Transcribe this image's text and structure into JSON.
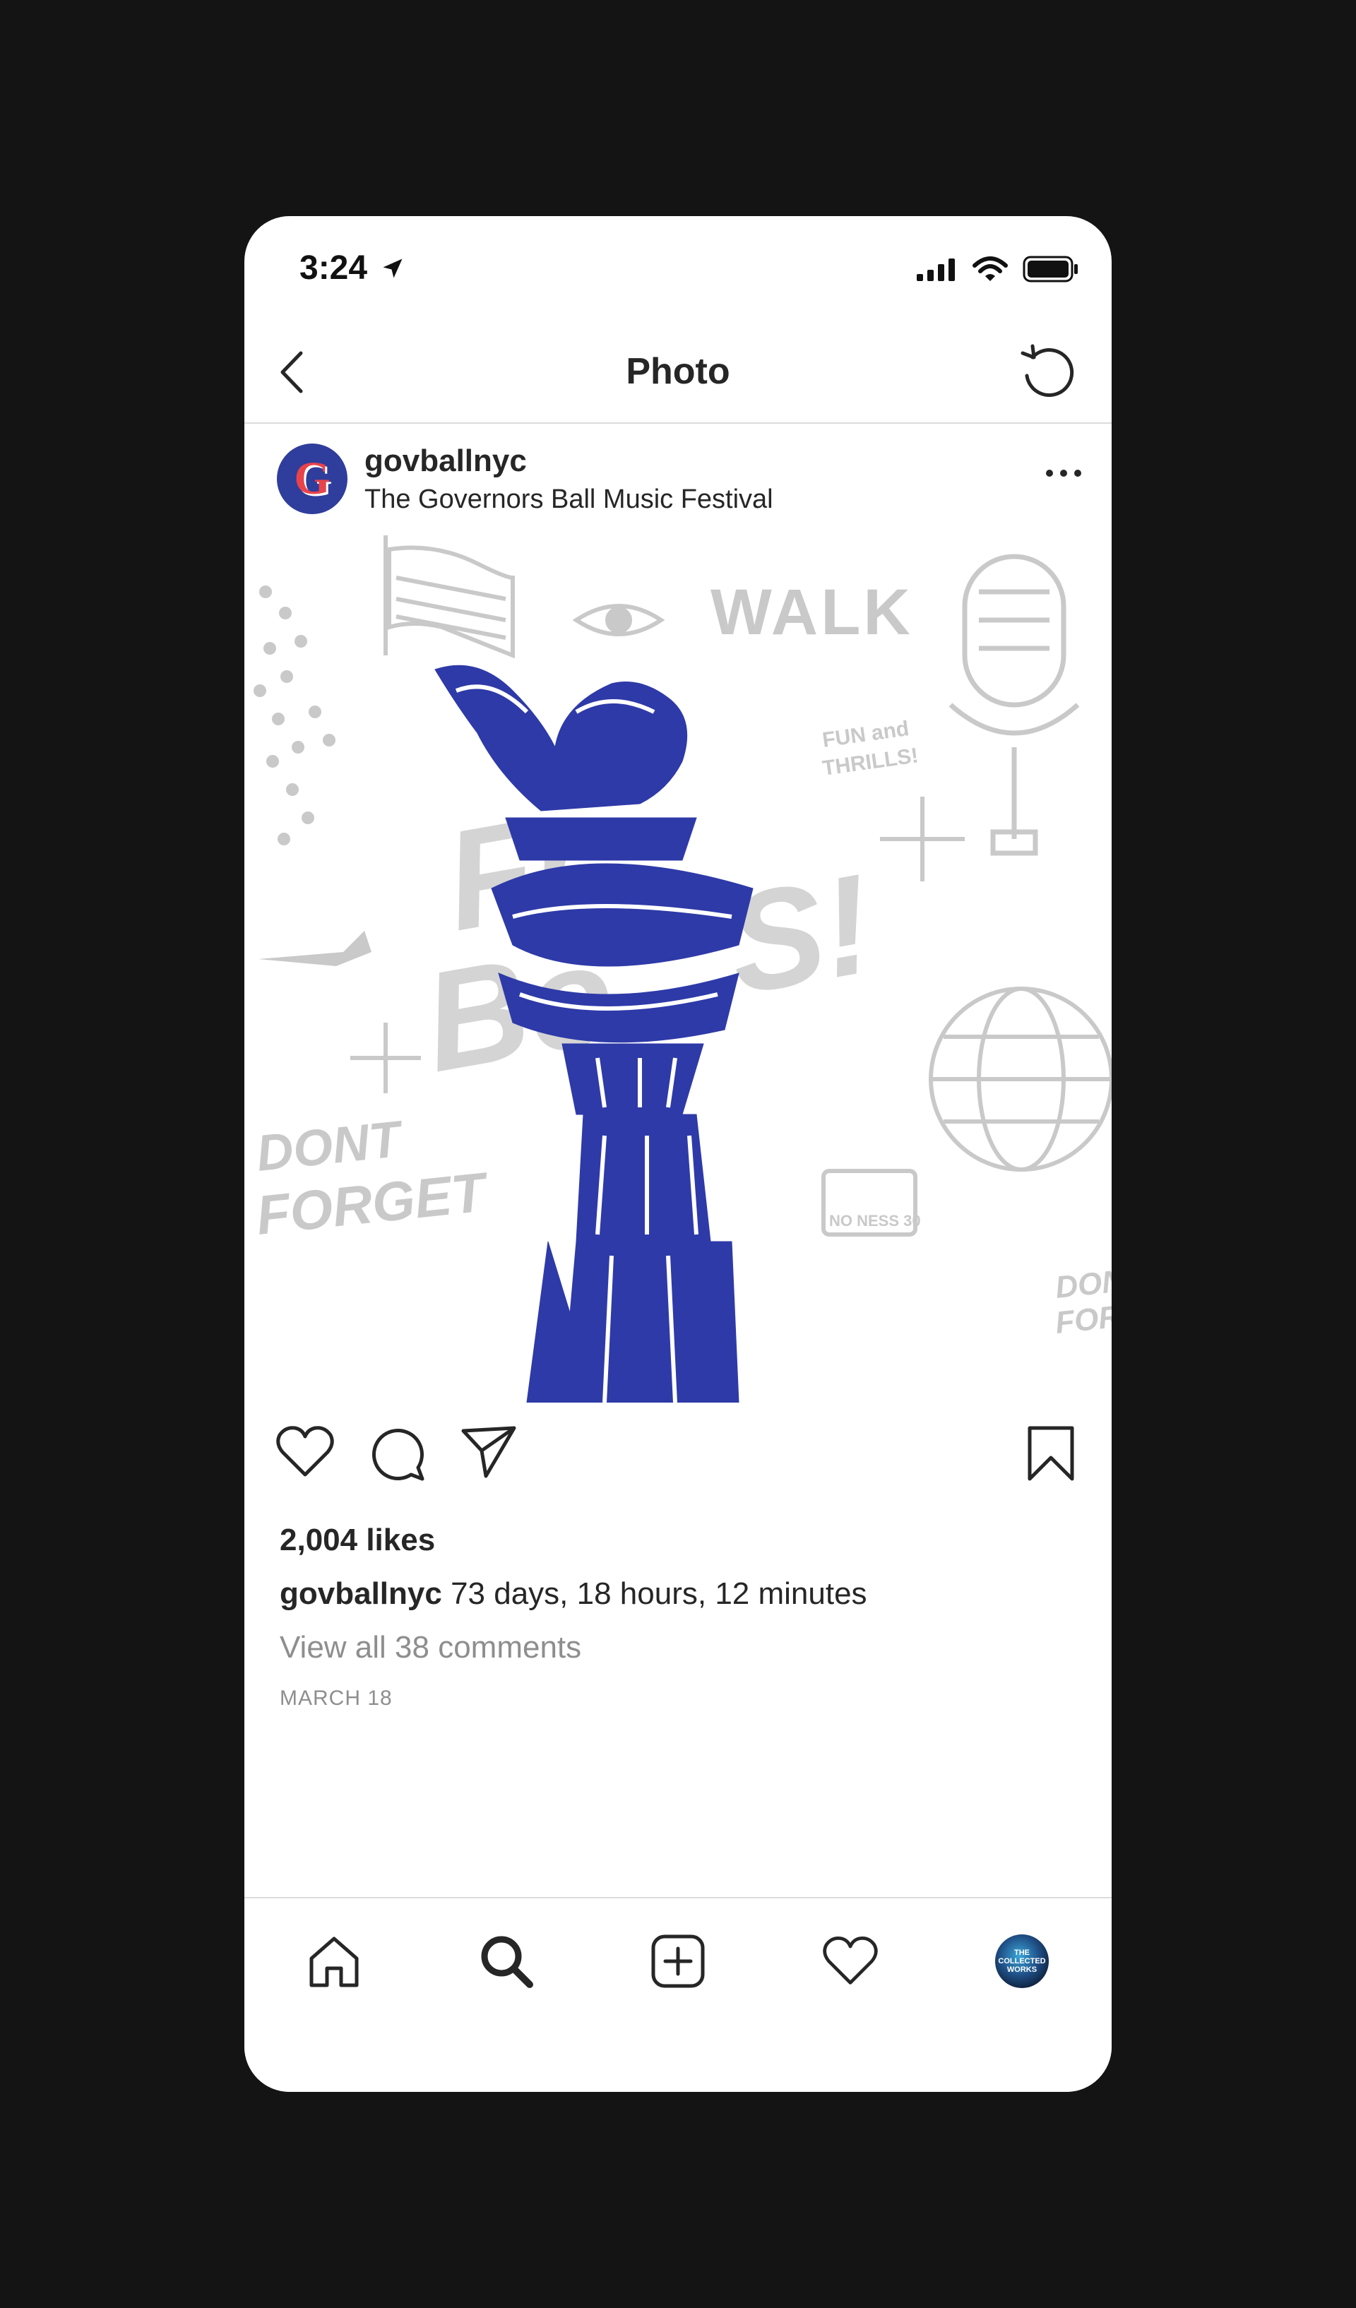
{
  "status_bar": {
    "time": "3:24",
    "icons": [
      "location-arrow-icon",
      "cellular-signal-icon",
      "wifi-icon",
      "battery-icon"
    ]
  },
  "nav": {
    "title": "Photo",
    "back_icon": "chevron-left-icon",
    "refresh_icon": "refresh-icon"
  },
  "post": {
    "avatar_letter": "G",
    "username": "govballnyc",
    "location": "The Governors Ball Music Festival",
    "more_icon": "more-horizontal-icon",
    "image": {
      "description_words": [
        "WALK",
        "FUN and THRILLS!",
        "DON'T FORGET",
        "NO NESS 30",
        "DON FOR"
      ],
      "accent_color": "#2e3aa8",
      "sketch_color": "#c9c9c9"
    },
    "likes": "2,004 likes",
    "caption_user": "govballnyc",
    "caption_text": "73 days, 18 hours, 12 minutes",
    "view_comments": "View all 38 comments",
    "date": "MARCH 18"
  },
  "actions": {
    "like_icon": "heart-icon",
    "comment_icon": "comment-icon",
    "share_icon": "send-icon",
    "save_icon": "bookmark-icon"
  },
  "tab_bar": {
    "items": [
      "home-icon",
      "search-icon",
      "add-post-icon",
      "activity-heart-icon",
      "profile-avatar"
    ],
    "profile_avatar_text": [
      "THE",
      "COLLECTED",
      "WORKS"
    ]
  },
  "colors": {
    "background": "#141414",
    "text_primary": "#262626",
    "text_secondary": "#8e8e8e",
    "divider": "#dbdbdb",
    "brand_blue": "#2f3d9c",
    "brand_red": "#e8434b"
  }
}
